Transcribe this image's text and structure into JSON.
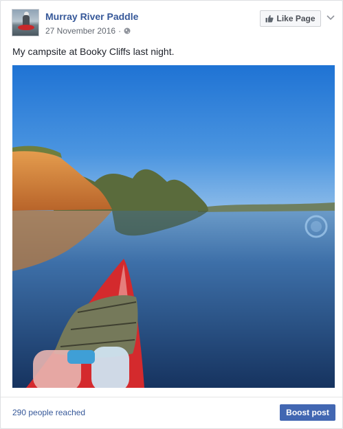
{
  "post": {
    "page_name": "Murray River Paddle",
    "date": "27 November 2016",
    "separator": "·",
    "privacy_icon": "globe-icon",
    "like_button_label": "Like Page",
    "like_icon": "thumbs-up-icon",
    "menu_icon": "chevron-down-icon",
    "text": "My campsite at Booky Cliffs last night.",
    "photo_description_icon": "photo"
  },
  "footer": {
    "reach_text": "290 people reached",
    "boost_label": "Boost post"
  },
  "colors": {
    "link": "#365899",
    "boost": "#4267b2",
    "sky": "#2f7fd6",
    "water": "#1f4a86",
    "cliff": "#d9903a",
    "kayak": "#e0262d"
  }
}
